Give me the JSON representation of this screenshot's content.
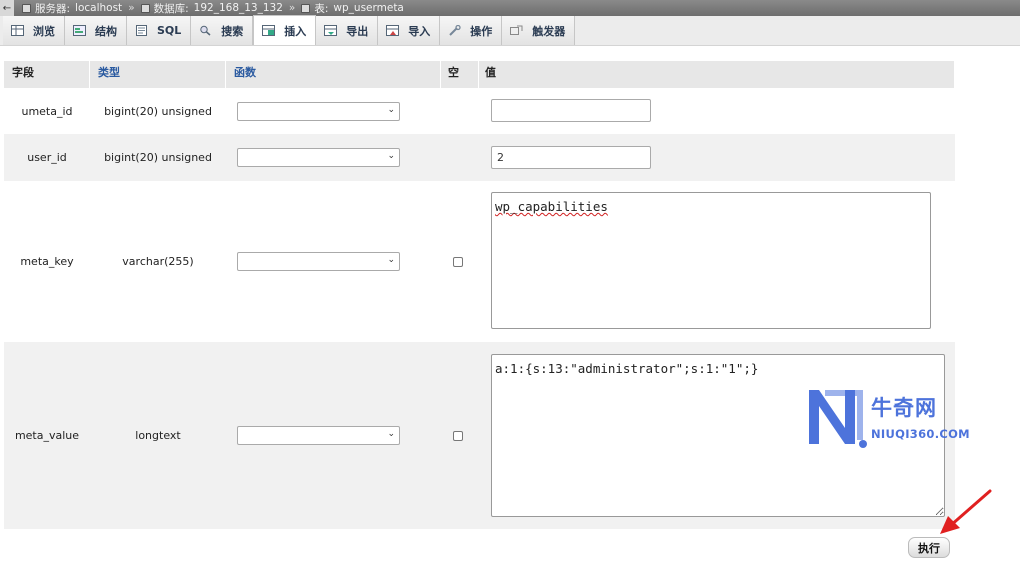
{
  "breadcrumb": {
    "server_label": "服务器:",
    "server_value": "localhost",
    "db_label": "数据库:",
    "db_value": "192_168_13_132",
    "table_label": "表:",
    "table_value": "wp_usermeta",
    "separator": "»"
  },
  "tabs": [
    {
      "label": "浏览",
      "icon": "browse-icon"
    },
    {
      "label": "结构",
      "icon": "structure-icon"
    },
    {
      "label": "SQL",
      "icon": "sql-icon"
    },
    {
      "label": "搜索",
      "icon": "search-icon"
    },
    {
      "label": "插入",
      "icon": "insert-icon",
      "active": true
    },
    {
      "label": "导出",
      "icon": "export-icon"
    },
    {
      "label": "导入",
      "icon": "import-icon"
    },
    {
      "label": "操作",
      "icon": "wrench-icon"
    },
    {
      "label": "触发器",
      "icon": "trigger-icon"
    }
  ],
  "table": {
    "headers": {
      "field": "字段",
      "type": "类型",
      "function": "函数",
      "null": "空",
      "value": "值"
    },
    "rows": [
      {
        "field": "umeta_id",
        "type": "bigint(20) unsigned",
        "function": "",
        "null": null,
        "value": ""
      },
      {
        "field": "user_id",
        "type": "bigint(20) unsigned",
        "function": "",
        "null": null,
        "value": "2"
      },
      {
        "field": "meta_key",
        "type": "varchar(255)",
        "function": "",
        "null": false,
        "value": "wp_capabilities"
      },
      {
        "field": "meta_value",
        "type": "longtext",
        "function": "",
        "null": false,
        "value": "a:1:{s:13:\"administrator\";s:1:\"1\";}"
      }
    ]
  },
  "actions": {
    "execute_label": "执行"
  },
  "watermark": {
    "name": "牛奇网",
    "domain": "NIUQI360.COM"
  },
  "colors": {
    "accent": "#2a5aa0",
    "watermark": "#3a64d8",
    "arrow": "#e02020"
  }
}
